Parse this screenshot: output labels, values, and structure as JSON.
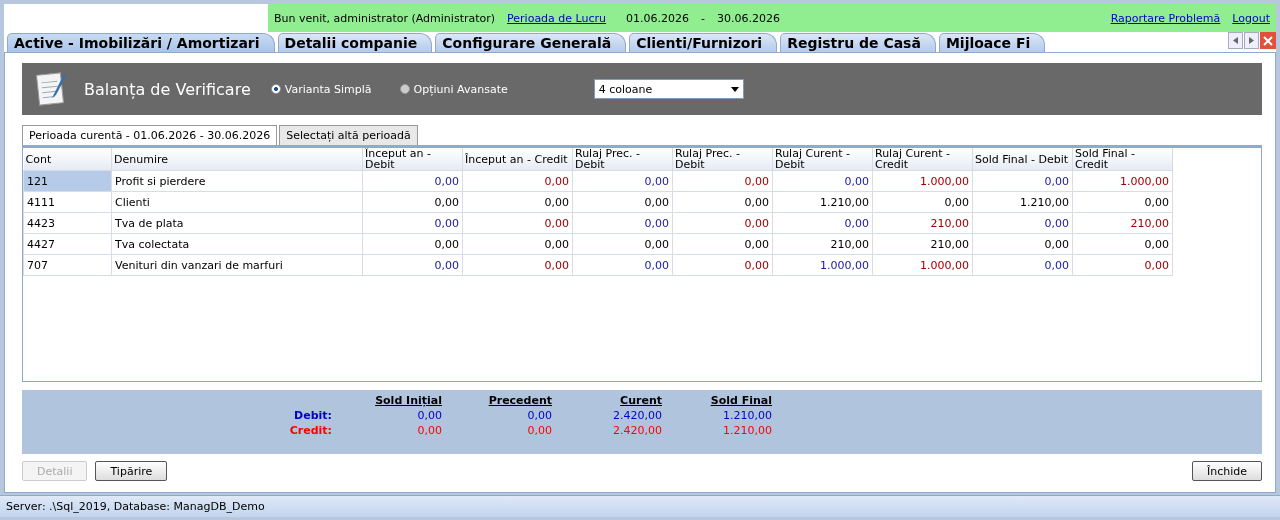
{
  "top_bar": {
    "welcome": "Bun venit, administrator (Administrator)",
    "period_link": "Perioada de Lucru",
    "period_start": "01.06.2026",
    "period_separator": "-",
    "period_end": "30.06.2026",
    "links": [
      "Raportare Problemă",
      "Logout"
    ]
  },
  "main_tabs": [
    {
      "label": "Active - Imobilizări / Amortizari",
      "selected": true
    },
    {
      "label": "Detalii companie",
      "selected": false
    },
    {
      "label": "Configurare Generală",
      "selected": false
    },
    {
      "label": "Clienti/Furnizori",
      "selected": false
    },
    {
      "label": "Registru de Casă",
      "selected": false
    },
    {
      "label": "Mijloace Fi",
      "selected": false
    }
  ],
  "header": {
    "title": "Balanța de Verificare",
    "options": [
      {
        "label": "Varianta Simplă",
        "selected": true
      },
      {
        "label": "Opțiuni Avansate",
        "selected": false
      }
    ],
    "columns_select": {
      "value": "4 coloane"
    }
  },
  "sub_tabs": [
    {
      "label": "Perioada curentă - 01.06.2026 - 30.06.2026",
      "selected": true
    },
    {
      "label": "Selectați altă perioadă",
      "selected": false
    }
  ],
  "table": {
    "columns": [
      "Cont",
      "Denumire",
      "Început an - Debit",
      "Început an - Credit",
      "Rulaj Prec. - Debit",
      "Rulaj Prec. - Debit",
      "Rulaj Curent - Debit",
      "Rulaj Curent - Credit",
      "Sold Final - Debit",
      "Sold Final - Credit"
    ],
    "rows": [
      {
        "kind": "colored",
        "selected": true,
        "cells": [
          "121",
          "Profit si pierdere",
          "0,00",
          "0,00",
          "0,00",
          "0,00",
          "0,00",
          "1.000,00",
          "0,00",
          "1.000,00"
        ]
      },
      {
        "kind": "plain",
        "selected": false,
        "cells": [
          "4111",
          "Clienti",
          "0,00",
          "0,00",
          "0,00",
          "0,00",
          "1.210,00",
          "0,00",
          "1.210,00",
          "0,00"
        ]
      },
      {
        "kind": "colored",
        "selected": false,
        "cells": [
          "4423",
          "Tva de plata",
          "0,00",
          "0,00",
          "0,00",
          "0,00",
          "0,00",
          "210,00",
          "0,00",
          "210,00"
        ]
      },
      {
        "kind": "plain",
        "selected": false,
        "cells": [
          "4427",
          "Tva colectata",
          "0,00",
          "0,00",
          "0,00",
          "0,00",
          "210,00",
          "210,00",
          "0,00",
          "0,00"
        ]
      },
      {
        "kind": "colored",
        "selected": false,
        "cells": [
          "707",
          "Venituri din vanzari de marfuri",
          "0,00",
          "0,00",
          "0,00",
          "0,00",
          "1.000,00",
          "1.000,00",
          "0,00",
          "0,00"
        ]
      }
    ]
  },
  "totals": {
    "headings": [
      "Sold Inițial",
      "Precedent",
      "Curent",
      "Sold Final"
    ],
    "rows": [
      {
        "kind": "debit",
        "label": "Debit:",
        "values": [
          "0,00",
          "0,00",
          "2.420,00",
          "1.210,00"
        ]
      },
      {
        "kind": "credit",
        "label": "Credit:",
        "values": [
          "0,00",
          "0,00",
          "2.420,00",
          "1.210,00"
        ]
      }
    ]
  },
  "buttons": [
    {
      "label": "Detalii",
      "disabled": true
    },
    {
      "label": "Tipărire",
      "disabled": false
    }
  ],
  "close_button": {
    "label": "Închide",
    "disabled": false
  },
  "status_bar": "Server: .\\Sql_2019, Database: ManagDB_Demo"
}
